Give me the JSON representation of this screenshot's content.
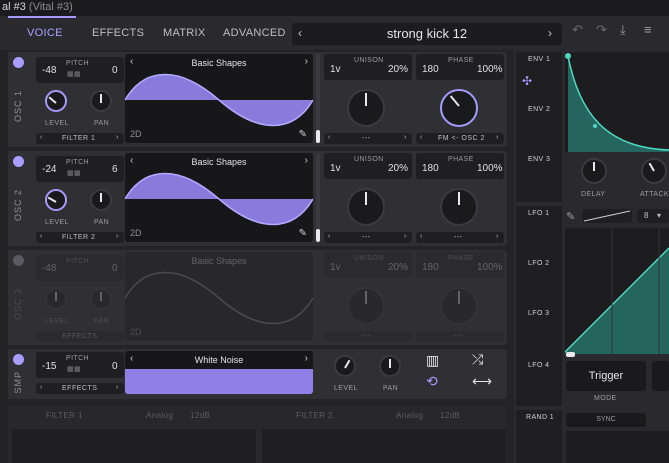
{
  "window": {
    "title": "al #3",
    "subtitle": "(Vital #3)"
  },
  "tabs": [
    {
      "label": "VOICE"
    },
    {
      "label": "EFFECTS"
    },
    {
      "label": "MATRIX"
    },
    {
      "label": "ADVANCED"
    }
  ],
  "preset": {
    "name": "strong kick 12"
  },
  "accent": "#a59bff",
  "osc1": {
    "label": "OSC 1",
    "pitch_label": "PITCH",
    "transpose": "-48",
    "tune": "0",
    "level_label": "LEVEL",
    "pan_label": "PAN",
    "filter_route": "FILTER 1",
    "wavetable": "Basic Shapes",
    "wave_tag": "2D",
    "unison_label": "UNISON",
    "unison_voices": "1v",
    "unison_detune": "20%",
    "phase_label": "PHASE",
    "phase": "180",
    "phase_rand": "100%",
    "unison_mode": "---",
    "distortion": "FM <- OSC 2"
  },
  "osc2": {
    "label": "OSC 2",
    "pitch_label": "PITCH",
    "transpose": "-24",
    "tune": "6",
    "level_label": "LEVEL",
    "pan_label": "PAN",
    "filter_route": "FILTER 2",
    "wavetable": "Basic Shapes",
    "wave_tag": "2D",
    "unison_label": "UNISON",
    "unison_voices": "1v",
    "unison_detune": "20%",
    "phase_label": "PHASE",
    "phase": "180",
    "phase_rand": "100%",
    "unison_mode": "---",
    "distortion": "---"
  },
  "osc3": {
    "label": "OSC 3",
    "pitch_label": "PITCH",
    "transpose": "-48",
    "tune": "0",
    "level_label": "LEVEL",
    "pan_label": "PAN",
    "filter_route": "EFFECTS",
    "wavetable": "Basic Shapes",
    "wave_tag": "2D",
    "unison_label": "UNISON",
    "unison_voices": "1v",
    "unison_detune": "20%",
    "phase_label": "PHASE",
    "phase": "180",
    "phase_rand": "100%",
    "unison_mode": "---",
    "distortion": "---"
  },
  "smp": {
    "label": "SMP",
    "pitch_label": "PITCH",
    "transpose": "-15",
    "tune": "0",
    "filter_route": "EFFECTS",
    "sample": "White Noise",
    "level_label": "LEVEL",
    "pan_label": "PAN"
  },
  "filters": {
    "f1_label": "FILTER 1",
    "f1_type": "Analog",
    "f1_slope": "12dB",
    "f2_label": "FILTER 2",
    "f2_type": "Analog",
    "f2_slope": "12dB"
  },
  "env": {
    "env1": "ENV 1",
    "env2": "ENV 2",
    "env3": "ENV 3",
    "delay_label": "DELAY",
    "attack_label": "ATTACK"
  },
  "lfo": {
    "lfo1": "LFO 1",
    "lfo2": "LFO 2",
    "lfo3": "LFO 3",
    "lfo4": "LFO 4",
    "division": "8",
    "trigger": "Trigger",
    "mode_label": "MODE"
  },
  "rand": {
    "rand1": "RAND 1",
    "sync_label": "SYNC"
  }
}
